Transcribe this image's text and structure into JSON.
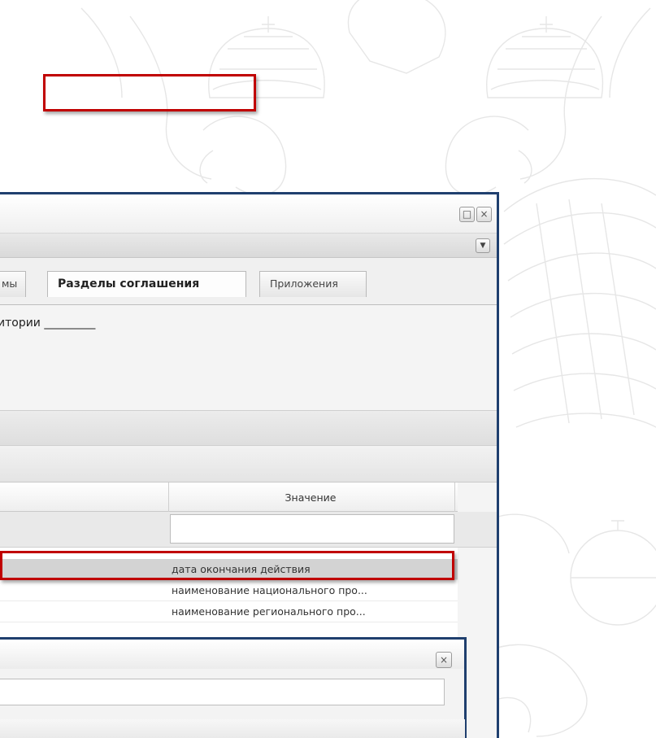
{
  "window": {
    "maximize_glyph": "□",
    "close_glyph": "×",
    "toolbar_dropdown_glyph": "▼"
  },
  "tabs": [
    {
      "label": "мы",
      "active": false
    },
    {
      "label": "Разделы соглашения",
      "active": true
    },
    {
      "label": "Приложения",
      "active": false
    }
  ],
  "section": {
    "text": "итории _________"
  },
  "grid": {
    "column_header": "Значение",
    "filter_value": "",
    "rows": [
      {
        "value": "дата окончания действия",
        "selected": true
      },
      {
        "value": "наименование национального про...",
        "selected": false
      },
      {
        "value": "наименование регионального про...",
        "selected": false
      }
    ]
  },
  "dialog": {
    "close_glyph": "×",
    "input_value": ""
  },
  "colors": {
    "frame": "#1f3f6e",
    "highlight": "#c00000",
    "emblem_line": "#e6e6e6"
  },
  "icons": {
    "maximize": "maximize-icon",
    "close": "close-icon",
    "dropdown": "chevron-down-icon",
    "emblem": "double-headed-eagle-watermark"
  }
}
